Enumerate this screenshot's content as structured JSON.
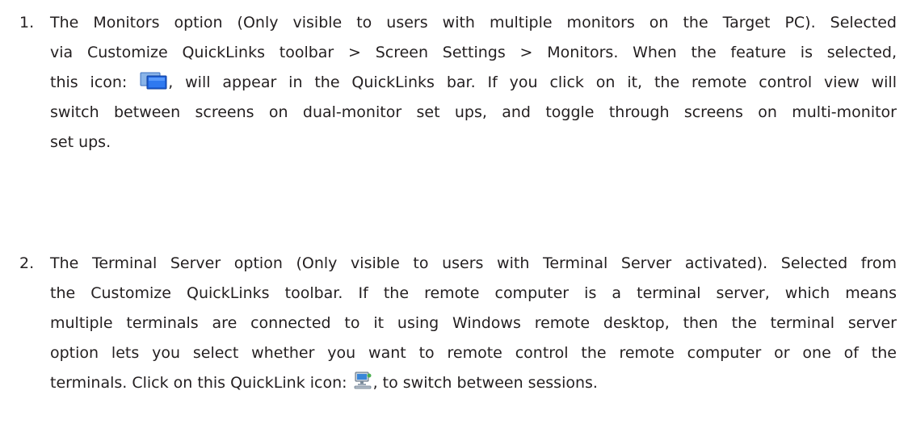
{
  "items": [
    {
      "number": "1.",
      "lines": [
        "The Monitors option (Only visible to users with multiple monitors on the Target PC). Selected",
        "via Customize QuickLinks toolbar > Screen Settings > Monitors. When the feature is selected,",
        {
          "before": "this icon:",
          "after": ", will appear in the QuickLinks bar. If you click on it, the remote control view will"
        },
        "switch between screens on dual-monitor set ups, and toggle through screens on multi-monitor",
        "set ups."
      ],
      "icon": "monitors-icon"
    },
    {
      "number": "2.",
      "lines": [
        "The Terminal Server option (Only visible to users with Terminal Server activated). Selected from",
        "the Customize QuickLinks toolbar. If the remote computer is a terminal server, which means",
        "multiple terminals are connected to it using Windows remote desktop, then the terminal server",
        "option lets you select whether you want to remote control the remote computer or one of the",
        {
          "before": "terminals. Click on this QuickLink icon:",
          "after": ", to switch between sessions."
        }
      ],
      "icon": "terminal-server-icon"
    }
  ]
}
